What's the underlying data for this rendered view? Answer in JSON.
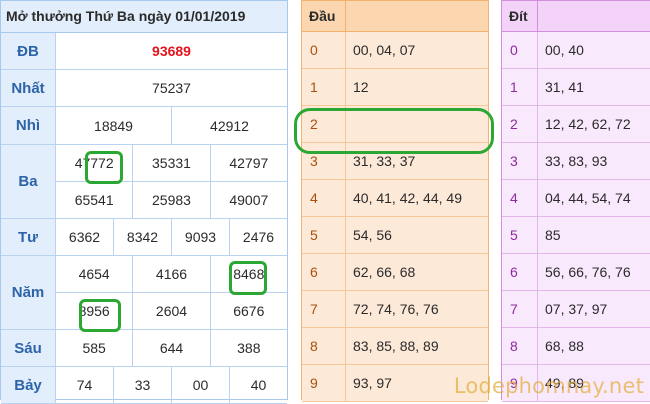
{
  "result": {
    "title": "Mở thưởng Thứ Ba ngày 01/01/2019",
    "rows": [
      {
        "label": "ĐB",
        "lines": [
          [
            "93689"
          ]
        ],
        "special": true
      },
      {
        "label": "Nhất",
        "lines": [
          [
            "75237"
          ]
        ]
      },
      {
        "label": "Nhì",
        "lines": [
          [
            "18849",
            "42912"
          ]
        ]
      },
      {
        "label": "Ba",
        "lines": [
          [
            "47772",
            "35331",
            "42797"
          ],
          [
            "65541",
            "25983",
            "49007"
          ]
        ]
      },
      {
        "label": "Tư",
        "lines": [
          [
            "6362",
            "8342",
            "9093",
            "2476"
          ]
        ]
      },
      {
        "label": "Năm",
        "lines": [
          [
            "4654",
            "4166",
            "8468"
          ],
          [
            "8956",
            "2604",
            "6676"
          ]
        ]
      },
      {
        "label": "Sáu",
        "lines": [
          [
            "585",
            "644",
            "388"
          ]
        ]
      },
      {
        "label": "Bảy",
        "lines": [
          [
            "74",
            "33",
            "00",
            "40"
          ]
        ]
      }
    ]
  },
  "dau": {
    "header": "Đầu",
    "rows": [
      {
        "key": "0",
        "value": "00, 04, 07"
      },
      {
        "key": "1",
        "value": "12"
      },
      {
        "key": "2",
        "value": ""
      },
      {
        "key": "3",
        "value": "31, 33, 37"
      },
      {
        "key": "4",
        "value": "40, 41, 42, 44, 49"
      },
      {
        "key": "5",
        "value": "54, 56"
      },
      {
        "key": "6",
        "value": "62, 66, 68"
      },
      {
        "key": "7",
        "value": "72, 74, 76, 76"
      },
      {
        "key": "8",
        "value": "83, 85, 88, 89"
      },
      {
        "key": "9",
        "value": "93, 97"
      }
    ]
  },
  "dit": {
    "header": "Đít",
    "rows": [
      {
        "key": "0",
        "value": "00, 40"
      },
      {
        "key": "1",
        "value": "31, 41"
      },
      {
        "key": "2",
        "value": "12, 42, 62, 72"
      },
      {
        "key": "3",
        "value": "33, 83, 93"
      },
      {
        "key": "4",
        "value": "04, 44, 54, 74"
      },
      {
        "key": "5",
        "value": "85"
      },
      {
        "key": "6",
        "value": "56, 66, 76, 76"
      },
      {
        "key": "7",
        "value": "07, 37, 97"
      },
      {
        "key": "8",
        "value": "68, 88"
      },
      {
        "key": "9",
        "value": "49, 89"
      }
    ]
  },
  "watermark": "Lodephomnay.net",
  "colors": {
    "special_prize": "#e5131b",
    "label_text": "#2d63a8",
    "highlight": "#2aa833",
    "dau_key": "#a8510e",
    "dit_key": "#8f2aa0"
  }
}
